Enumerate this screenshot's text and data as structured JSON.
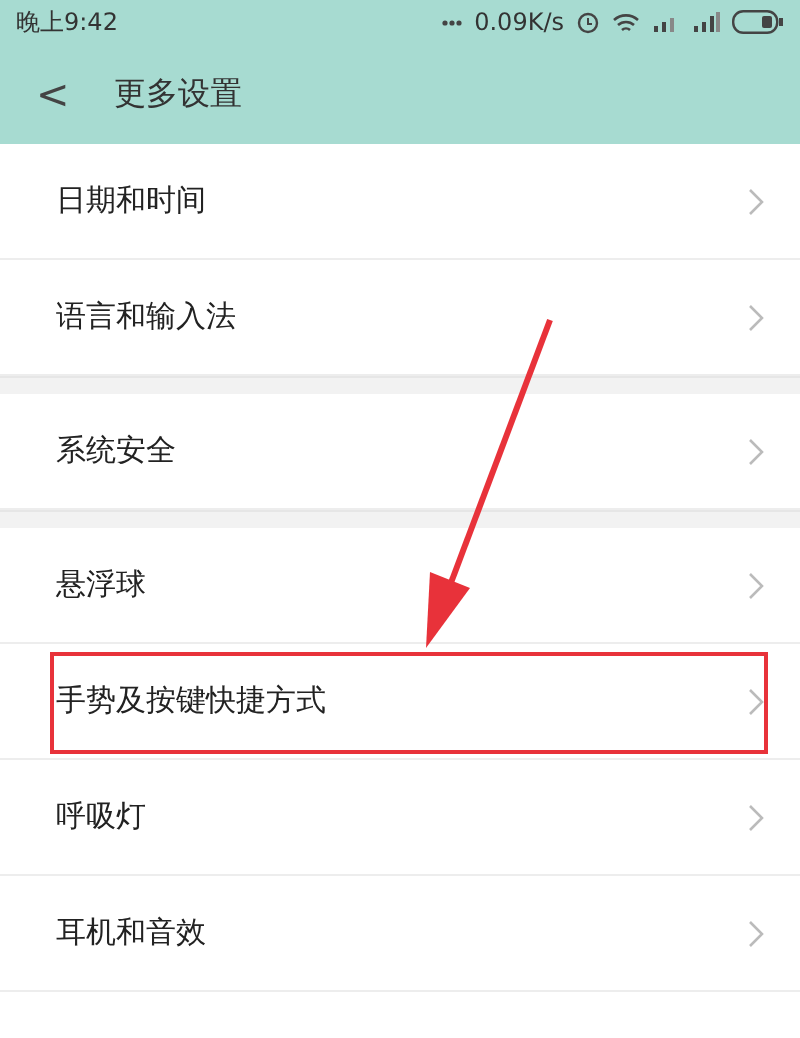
{
  "status_bar": {
    "time": "晚上9:42",
    "speed": "0.09K/s"
  },
  "header": {
    "back": "<",
    "title": "更多设置"
  },
  "sections": [
    {
      "items": [
        {
          "label": "日期和时间",
          "highlighted": false
        },
        {
          "label": "语言和输入法",
          "highlighted": false
        }
      ]
    },
    {
      "items": [
        {
          "label": "系统安全",
          "highlighted": false
        }
      ]
    },
    {
      "items": [
        {
          "label": "悬浮球",
          "highlighted": false
        },
        {
          "label": "手势及按键快捷方式",
          "highlighted": true
        },
        {
          "label": "呼吸灯",
          "highlighted": false
        },
        {
          "label": "耳机和音效",
          "highlighted": false
        }
      ]
    }
  ]
}
